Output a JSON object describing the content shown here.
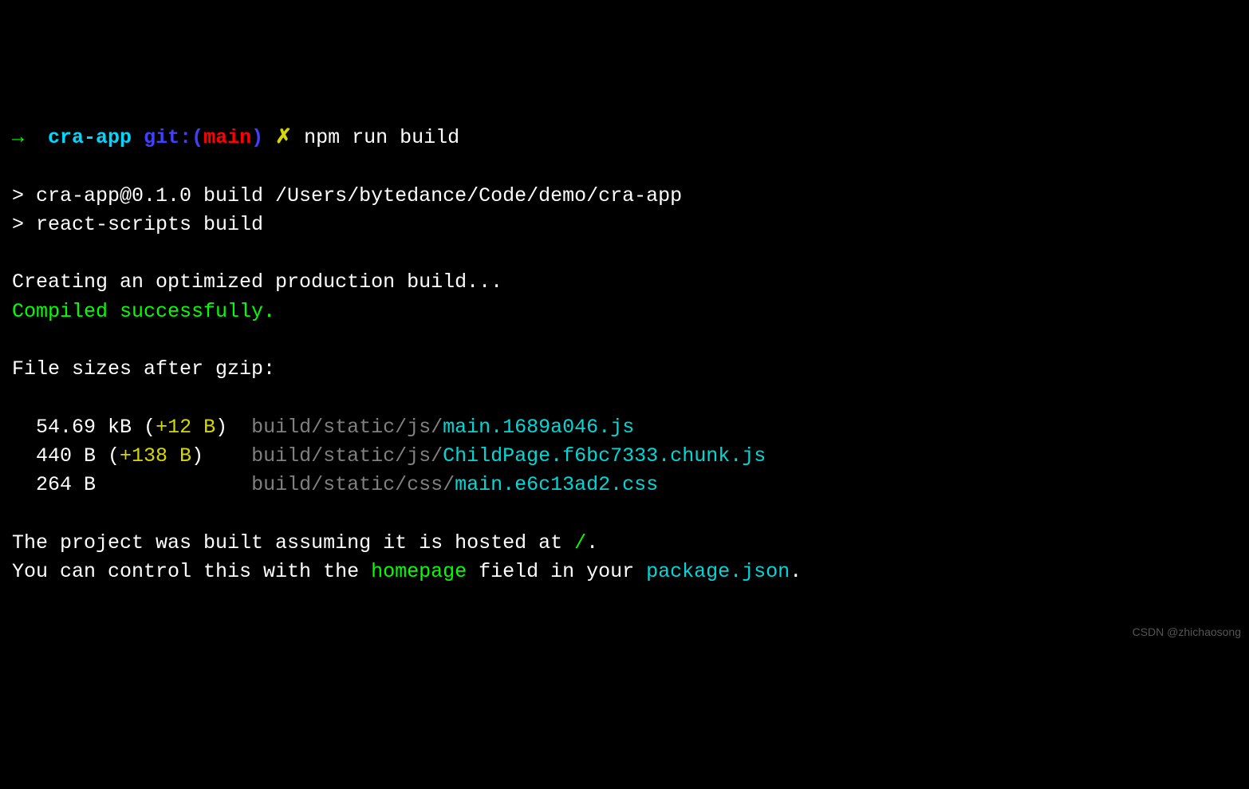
{
  "prompt": {
    "arrow": "→",
    "dir": "cra-app",
    "git_label": "git:(",
    "branch": "main",
    "git_close": ")",
    "dirty_marker": "✗",
    "command": "npm run build"
  },
  "npm_header": {
    "line1": "> cra-app@0.1.0 build /Users/bytedance/Code/demo/cra-app",
    "line2": "> react-scripts build"
  },
  "build": {
    "creating": "Creating an optimized production build...",
    "compiled": "Compiled successfully.",
    "sizes_header": "File sizes after gzip:"
  },
  "files": [
    {
      "size": "54.69 kB ",
      "delta_open": "(",
      "delta": "+12 B",
      "delta_close": ")",
      "pad": "  ",
      "path_dim": "build/static/js/",
      "path_file": "main.1689a046.js"
    },
    {
      "size": "440 B ",
      "delta_open": "(",
      "delta": "+138 B",
      "delta_close": ")",
      "pad": "    ",
      "path_dim": "build/static/js/",
      "path_file": "ChildPage.f6bc7333.chunk.js"
    },
    {
      "size": "264 B",
      "delta_open": "",
      "delta": "",
      "delta_close": "",
      "pad": "             ",
      "path_dim": "build/static/css/",
      "path_file": "main.e6c13ad2.css"
    }
  ],
  "footer": {
    "hosted_pre": "The project was built assuming it is hosted at ",
    "hosted_path": "/",
    "hosted_post": ".",
    "control_pre": "You can control this with the ",
    "homepage_word": "homepage",
    "control_mid": " field in your ",
    "package_word": "package.json",
    "control_post": "."
  },
  "watermark": "CSDN @zhichaosong"
}
